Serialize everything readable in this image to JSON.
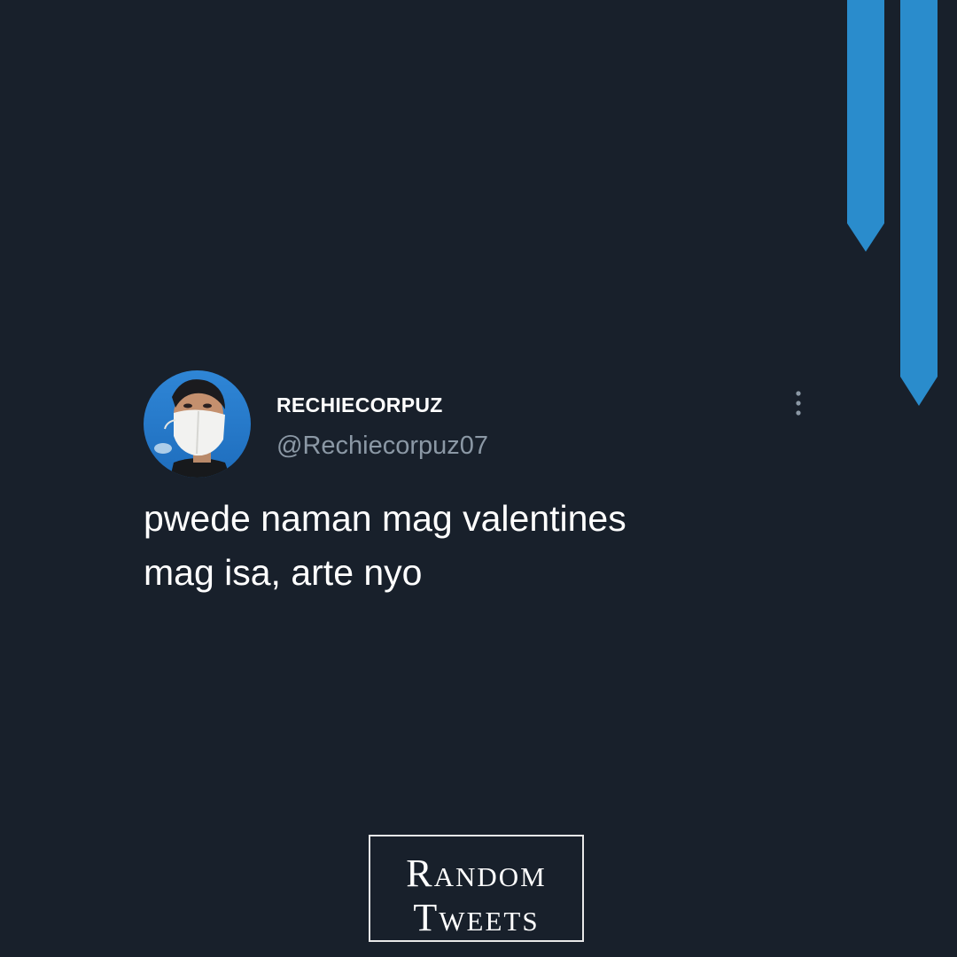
{
  "tweet": {
    "display_name": "RECHIECORPUZ",
    "handle": "@Rechiecorpuz07",
    "text": "pwede naman mag valentines\nmag isa, arte nyo",
    "more_icon": "vertical-ellipsis-icon",
    "avatar_icon": "profile-photo-masked-man"
  },
  "watermark": {
    "line1": "Random",
    "line2": "Tweets"
  },
  "colors": {
    "background": "#18202b",
    "ribbon_blue": "#2a8ccc",
    "handle_gray": "#8b98a5",
    "text_white": "#ffffff"
  }
}
